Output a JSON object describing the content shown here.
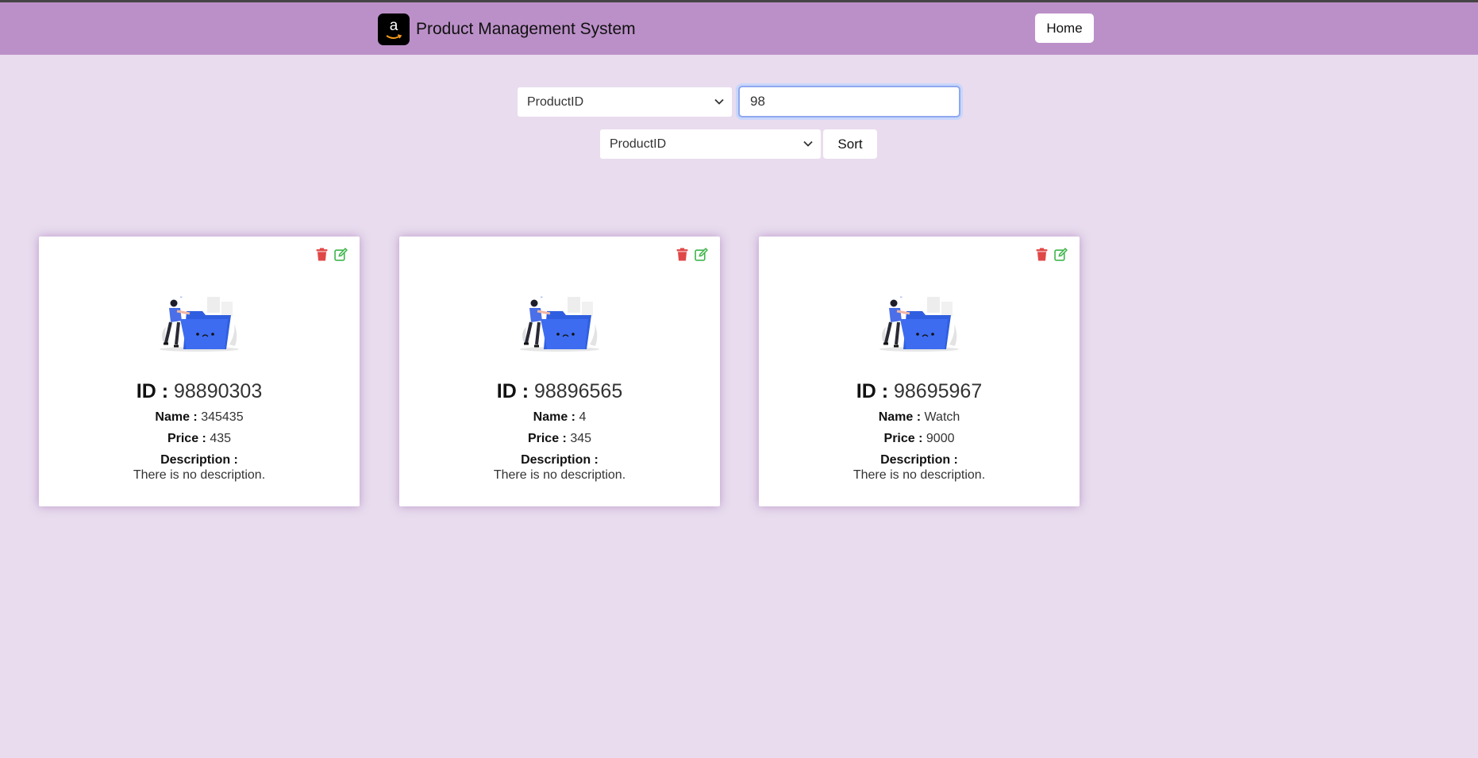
{
  "header": {
    "logo_letter": "a",
    "title": "Product Management System",
    "home_label": "Home"
  },
  "search": {
    "field_select": "ProductID",
    "query": "98"
  },
  "sort": {
    "field_select": "ProductID",
    "button_label": "Sort"
  },
  "labels": {
    "id": "ID :",
    "name": "Name :",
    "price": "Price :",
    "description": "Description :"
  },
  "products": [
    {
      "id": "98890303",
      "name": "345435",
      "price": "435",
      "description": "There is no description."
    },
    {
      "id": "98896565",
      "name": "4",
      "price": "345",
      "description": "There is no description."
    },
    {
      "id": "98695967",
      "name": "Watch",
      "price": "9000",
      "description": "There is no description."
    }
  ],
  "icons": {
    "delete": "trash-icon",
    "edit": "edit-icon",
    "delete_color": "#e04848",
    "edit_color": "#3fb54a"
  },
  "colors": {
    "header_bg": "#bb90c8",
    "page_bg": "#e8dcee",
    "illustration_folder": "#3d6cf0"
  }
}
